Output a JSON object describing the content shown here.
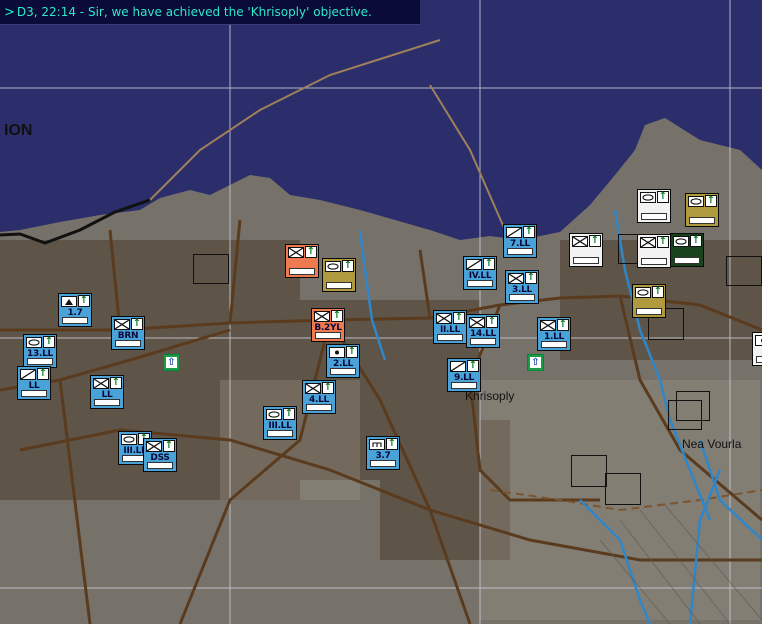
{
  "status_message": {
    "arrow": ">",
    "text": "D3, 22:14 - Sir, we have achieved the 'Khrisoply' objective."
  },
  "map": {
    "region_label": "ION",
    "towns": [
      {
        "name": "Khrisoply"
      },
      {
        "name": "Nea Vourla"
      }
    ]
  },
  "units": [
    {
      "label": "7.LL",
      "kind": "recon",
      "color": "blue"
    },
    {
      "label": "IV.LL",
      "kind": "recon",
      "color": "blue"
    },
    {
      "label": "3.LL",
      "kind": "infantry",
      "color": "blue"
    },
    {
      "label": "1.7",
      "kind": "mountain",
      "color": "blue"
    },
    {
      "label": "BRN",
      "kind": "infantry",
      "color": "blue"
    },
    {
      "label": "13.LL",
      "kind": "armor",
      "color": "blue"
    },
    {
      "label": "LL",
      "kind": "recon",
      "color": "blue"
    },
    {
      "label": "LL",
      "kind": "infantry",
      "color": "blue"
    },
    {
      "label": "",
      "kind": "infantry",
      "color": "salmon"
    },
    {
      "label": "",
      "kind": "armor",
      "color": "olive"
    },
    {
      "label": "B.2YL",
      "kind": "infantry",
      "color": "salmon"
    },
    {
      "label": "2.LL",
      "kind": "artillery",
      "color": "blue"
    },
    {
      "label": "4.LL",
      "kind": "infantry",
      "color": "blue"
    },
    {
      "label": "III.LL",
      "kind": "armor",
      "color": "blue"
    },
    {
      "label": "III.LL",
      "kind": "armor",
      "color": "blue"
    },
    {
      "label": "DSS",
      "kind": "infantry",
      "color": "blue"
    },
    {
      "label": "3.7",
      "kind": "engineer",
      "color": "blue"
    },
    {
      "label": "II.LL",
      "kind": "infantry",
      "color": "blue"
    },
    {
      "label": "14.LL",
      "kind": "infantry",
      "color": "blue"
    },
    {
      "label": "9.LL",
      "kind": "recon",
      "color": "blue"
    },
    {
      "label": "1.LL",
      "kind": "infantry",
      "color": "blue"
    },
    {
      "label": "",
      "kind": "infantry",
      "color": "white"
    },
    {
      "label": "",
      "kind": "armor",
      "color": "white"
    },
    {
      "label": "",
      "kind": "armor",
      "color": "olive"
    },
    {
      "label": "",
      "kind": "infantry",
      "color": "white"
    },
    {
      "label": "",
      "kind": "armor",
      "color": "dgreen"
    },
    {
      "label": "",
      "kind": "armor",
      "color": "olive"
    },
    {
      "label": "",
      "kind": "artillery",
      "color": "white"
    }
  ],
  "colors": {
    "sea": "#2b2e6a",
    "land": "#7a766d",
    "road": "#6b4a2a",
    "river": "#2f86c8",
    "message": "#2ee8c8"
  }
}
